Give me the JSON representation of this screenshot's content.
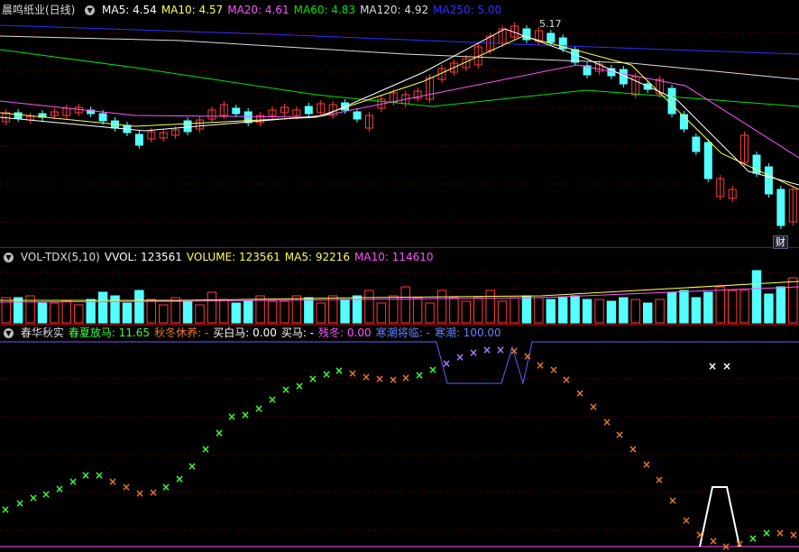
{
  "colors": {
    "background": "#000000",
    "up": "#ff3c3c",
    "down": "#54ffff",
    "ma5": "#ffffff",
    "ma10": "#ffff54",
    "ma20": "#ff54ff",
    "ma60": "#00e600",
    "ma120": "#dddddd",
    "ma250": "#3030ff",
    "green_x": "#3cff3c",
    "orange_x": "#e8782c",
    "purple_x": "#b07cff",
    "white_x": "#ffffff",
    "blue_line": "#6060ff",
    "divider": "#b00000"
  },
  "price_panel": {
    "stock_title": "晨鸣纸业(日线)",
    "indicators": [
      {
        "label": "MA5: 4.54",
        "color": "#ffffff"
      },
      {
        "label": "MA10: 4.57",
        "color": "#ffff54"
      },
      {
        "label": "MA20: 4.61",
        "color": "#ff54ff"
      },
      {
        "label": "MA60: 4.83",
        "color": "#00e600"
      },
      {
        "label": "MA120: 4.92",
        "color": "#dddddd"
      },
      {
        "label": "MA250: 5.00",
        "color": "#3030ff"
      }
    ],
    "high_label": "5.17",
    "event_tag": "财"
  },
  "volume_panel": {
    "indicators": [
      {
        "label": "VOL-TDX(5,10)",
        "color": "#dddddd"
      },
      {
        "label": "VVOL: 123561",
        "color": "#ffffff"
      },
      {
        "label": "VOLUME: 123561",
        "color": "#ffff54"
      },
      {
        "label": "MA5: 92216",
        "color": "#ffff54"
      },
      {
        "label": "MA10: 114610",
        "color": "#ff54ff"
      }
    ]
  },
  "indicator_panel": {
    "indicators": [
      {
        "label": "春华秋实",
        "color": "#dddddd"
      },
      {
        "label": "春夏放马: 11.65",
        "color": "#3cff3c"
      },
      {
        "label": "秋冬休养: -",
        "color": "#e8782c"
      },
      {
        "label": "买白马: 0.00",
        "color": "#ffffff"
      },
      {
        "label": "买马: -",
        "color": "#ffffff"
      },
      {
        "label": "残冬: 0.00",
        "color": "#ff54ff"
      },
      {
        "label": "寒潮将临: -",
        "color": "#6080ff"
      },
      {
        "label": "寒潮: 100.00",
        "color": "#6080ff"
      }
    ]
  }
}
